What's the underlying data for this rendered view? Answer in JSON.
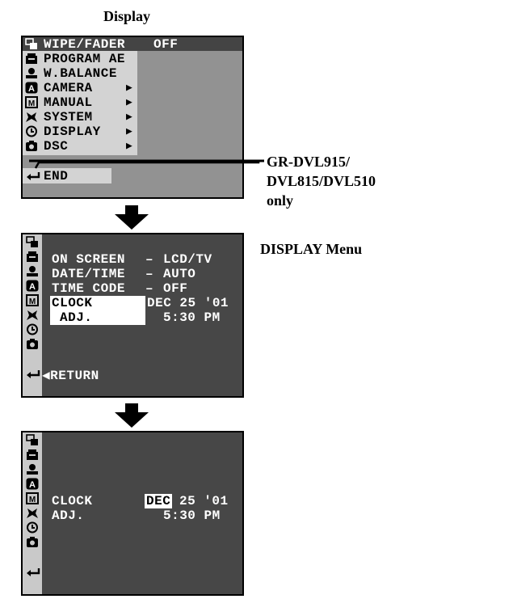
{
  "headings": {
    "display": "Display",
    "display_menu": "DISPLAY Menu"
  },
  "callout": {
    "line1": "GR-DVL915/",
    "line2": "DVL815/DVL510",
    "line3": "only"
  },
  "screen1": {
    "items": [
      {
        "label": "WIPE/FADER",
        "value": "OFF",
        "icon": "wipe-fader-icon"
      },
      {
        "label": "PROGRAM AE",
        "icon": "program-ae-icon"
      },
      {
        "label": "W.BALANCE",
        "icon": "white-balance-icon"
      },
      {
        "label": "CAMERA",
        "arrow": "▶",
        "icon": "camera-icon"
      },
      {
        "label": "MANUAL",
        "arrow": "▶",
        "icon": "manual-icon"
      },
      {
        "label": "SYSTEM",
        "arrow": "▶",
        "icon": "system-icon"
      },
      {
        "label": "DISPLAY",
        "arrow": "▶",
        "icon": "display-icon"
      },
      {
        "label": "DSC",
        "arrow": "▶",
        "icon": "dsc-icon"
      }
    ],
    "end_label": "END"
  },
  "screen2": {
    "rows": [
      {
        "label": "ON SCREEN",
        "dash": "–",
        "value": "LCD/TV"
      },
      {
        "label": "DATE/TIME",
        "dash": "–",
        "value": "AUTO"
      },
      {
        "label": "TIME CODE",
        "dash": "–",
        "value": "OFF"
      }
    ],
    "clock_label_1": "CLOCK",
    "clock_label_2": "ADJ.",
    "clock_date": "DEC 25 '01",
    "clock_time": "5:30 PM",
    "return_label": "◀RETURN"
  },
  "screen3": {
    "clock_label_1": "CLOCK",
    "clock_label_2": "ADJ.",
    "month": "DEC",
    "day_year": "25 '01",
    "clock_time": "5:30 PM"
  },
  "colors": {
    "screen_bg": "#4a4a4a",
    "menu_bg": "#d0d0d0",
    "sidebar": "#c9c9c9",
    "osd_text": "#ffffff"
  }
}
